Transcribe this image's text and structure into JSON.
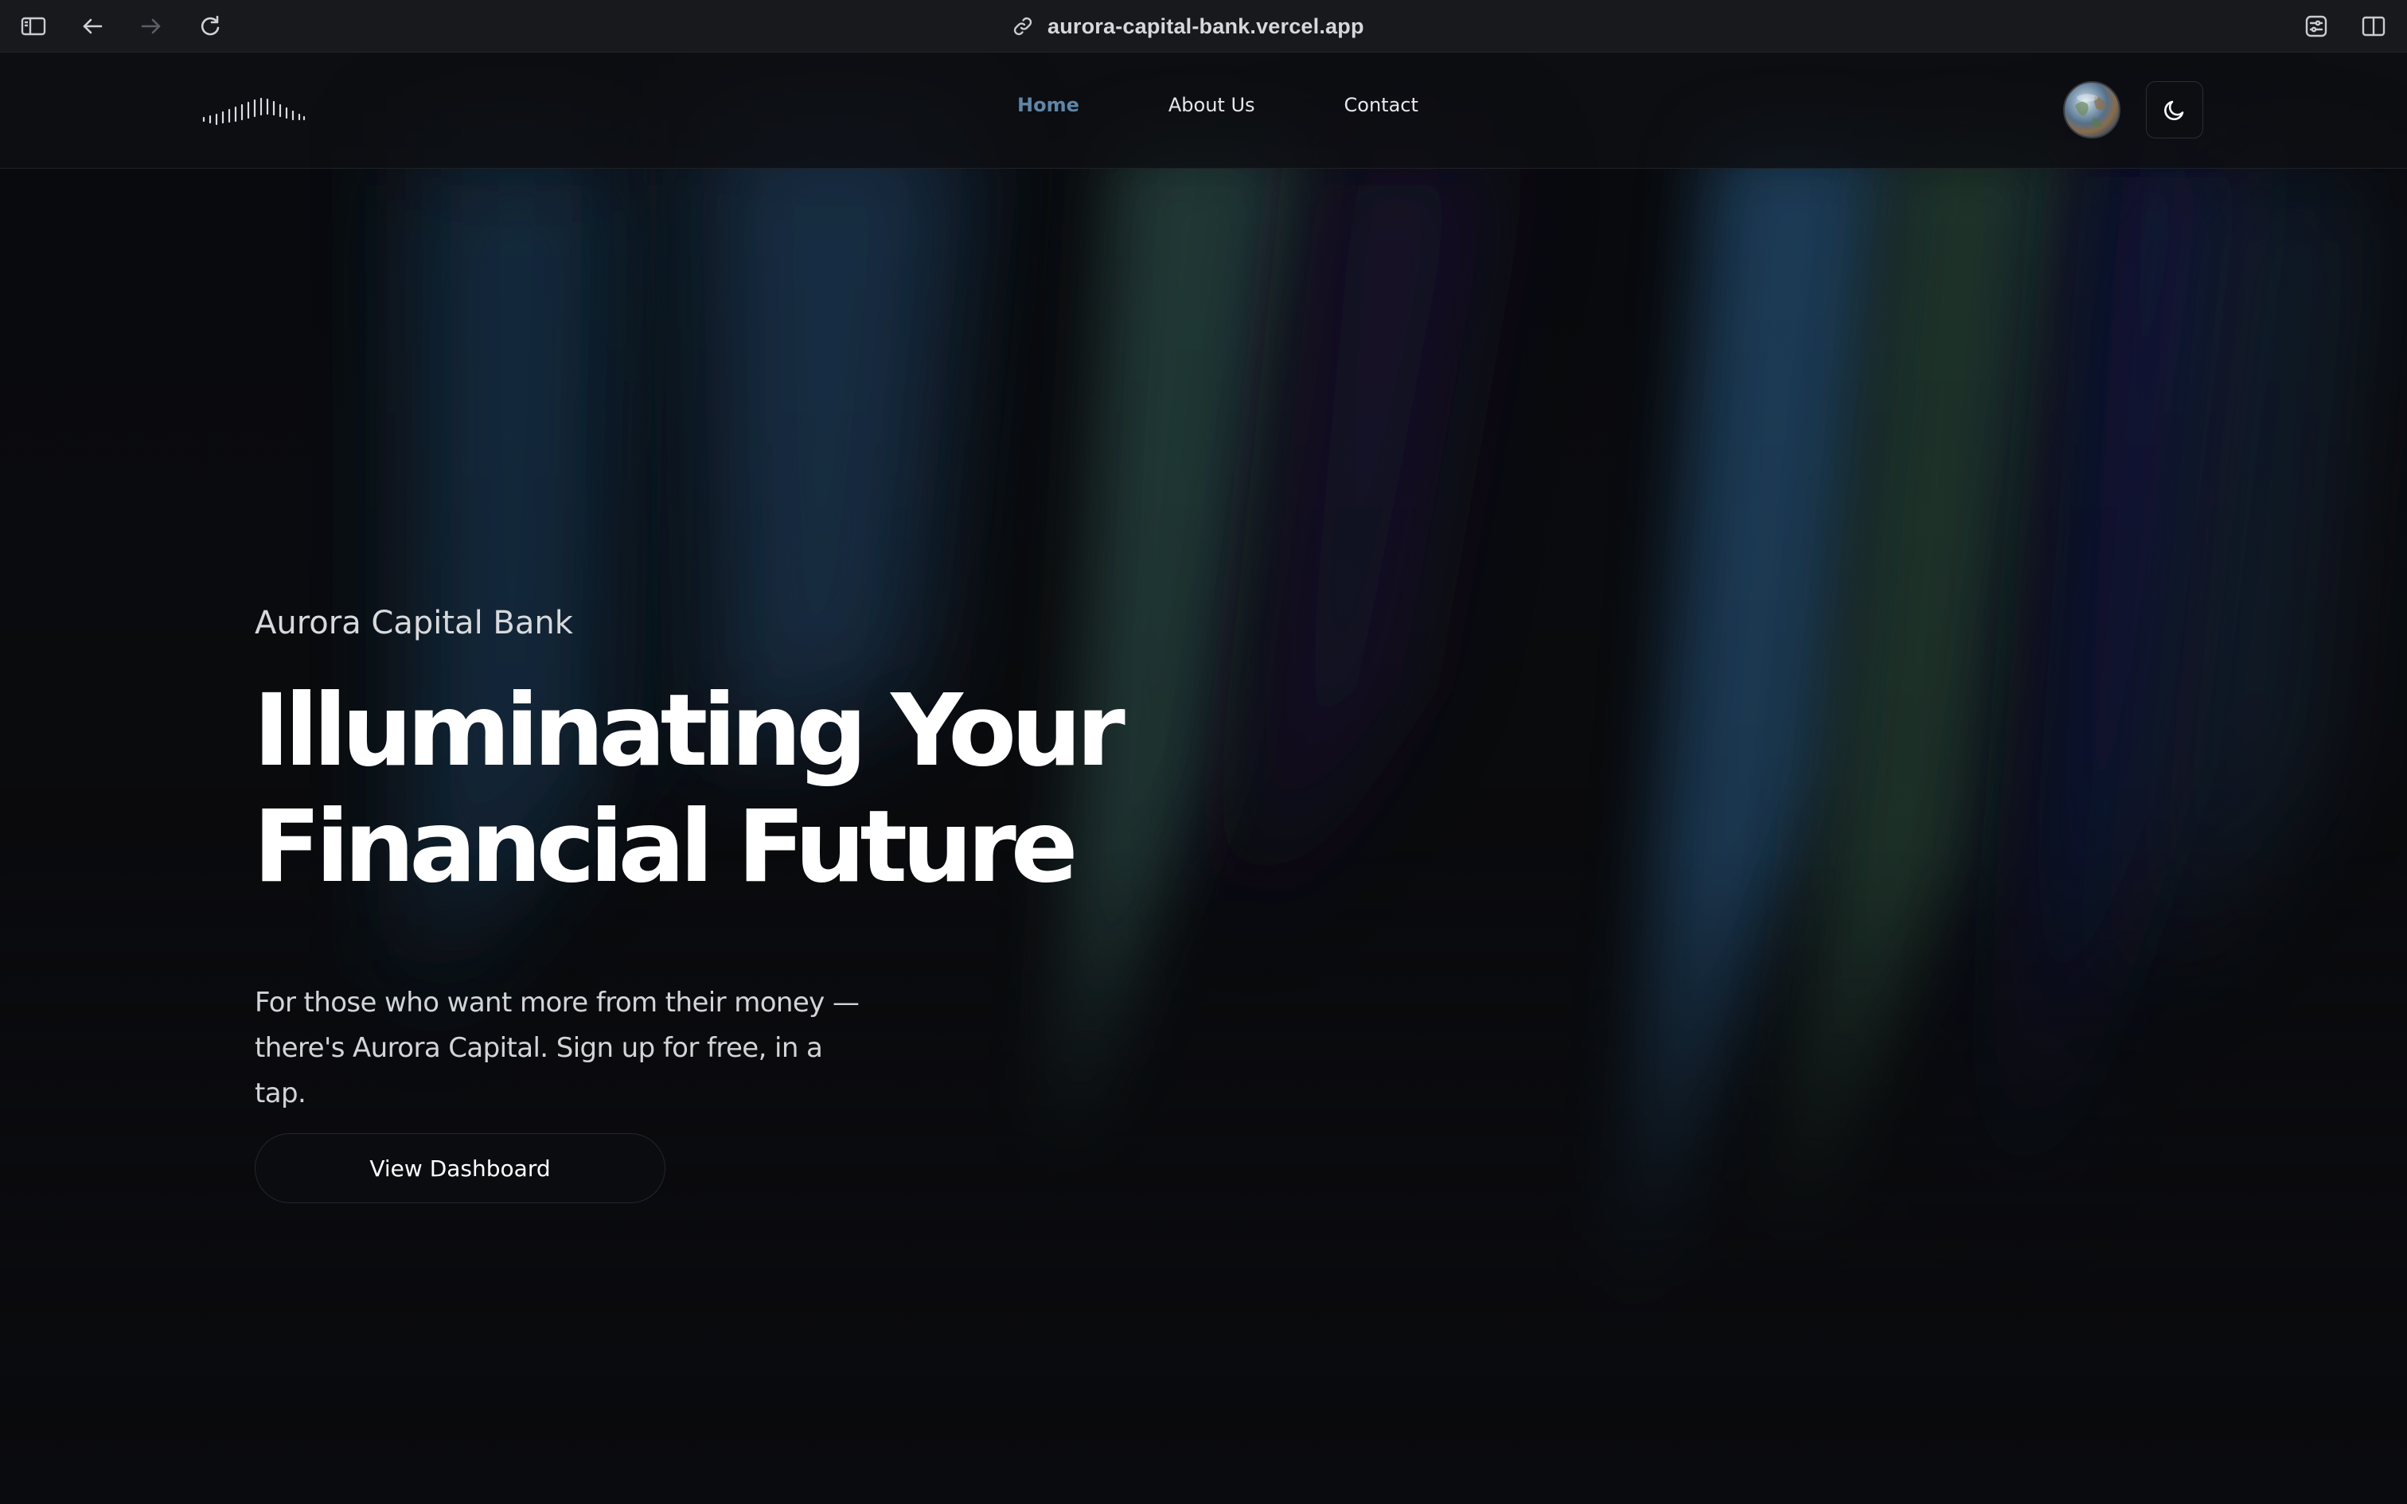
{
  "browser": {
    "url": "aurora-capital-bank.vercel.app",
    "icons": {
      "sidebar": "sidebar-icon",
      "back": "back-arrow-icon",
      "forward": "forward-arrow-icon",
      "reload": "reload-icon",
      "link": "link-icon",
      "extension": "extension-icon",
      "split_view": "split-view-icon"
    }
  },
  "nav": {
    "logo_icon": "aurora-logo-icon",
    "links": [
      {
        "label": "Home",
        "active": true
      },
      {
        "label": "About Us",
        "active": false
      },
      {
        "label": "Contact",
        "active": false
      }
    ],
    "active_color": "#5f86a8",
    "avatar_icon": "globe-avatar-icon",
    "theme_toggle_icon": "moon-icon"
  },
  "hero": {
    "kicker": "Aurora Capital Bank",
    "title_line1": "Illuminating Your",
    "title_line2": "Financial Future",
    "subtitle_line1": "For those who want more from their money —",
    "subtitle_line2": "there's Aurora Capital. Sign up for free, in a tap.",
    "cta_label": "View Dashboard"
  },
  "colors": {
    "background": "#0a0b0e",
    "text": "#ffffff"
  }
}
